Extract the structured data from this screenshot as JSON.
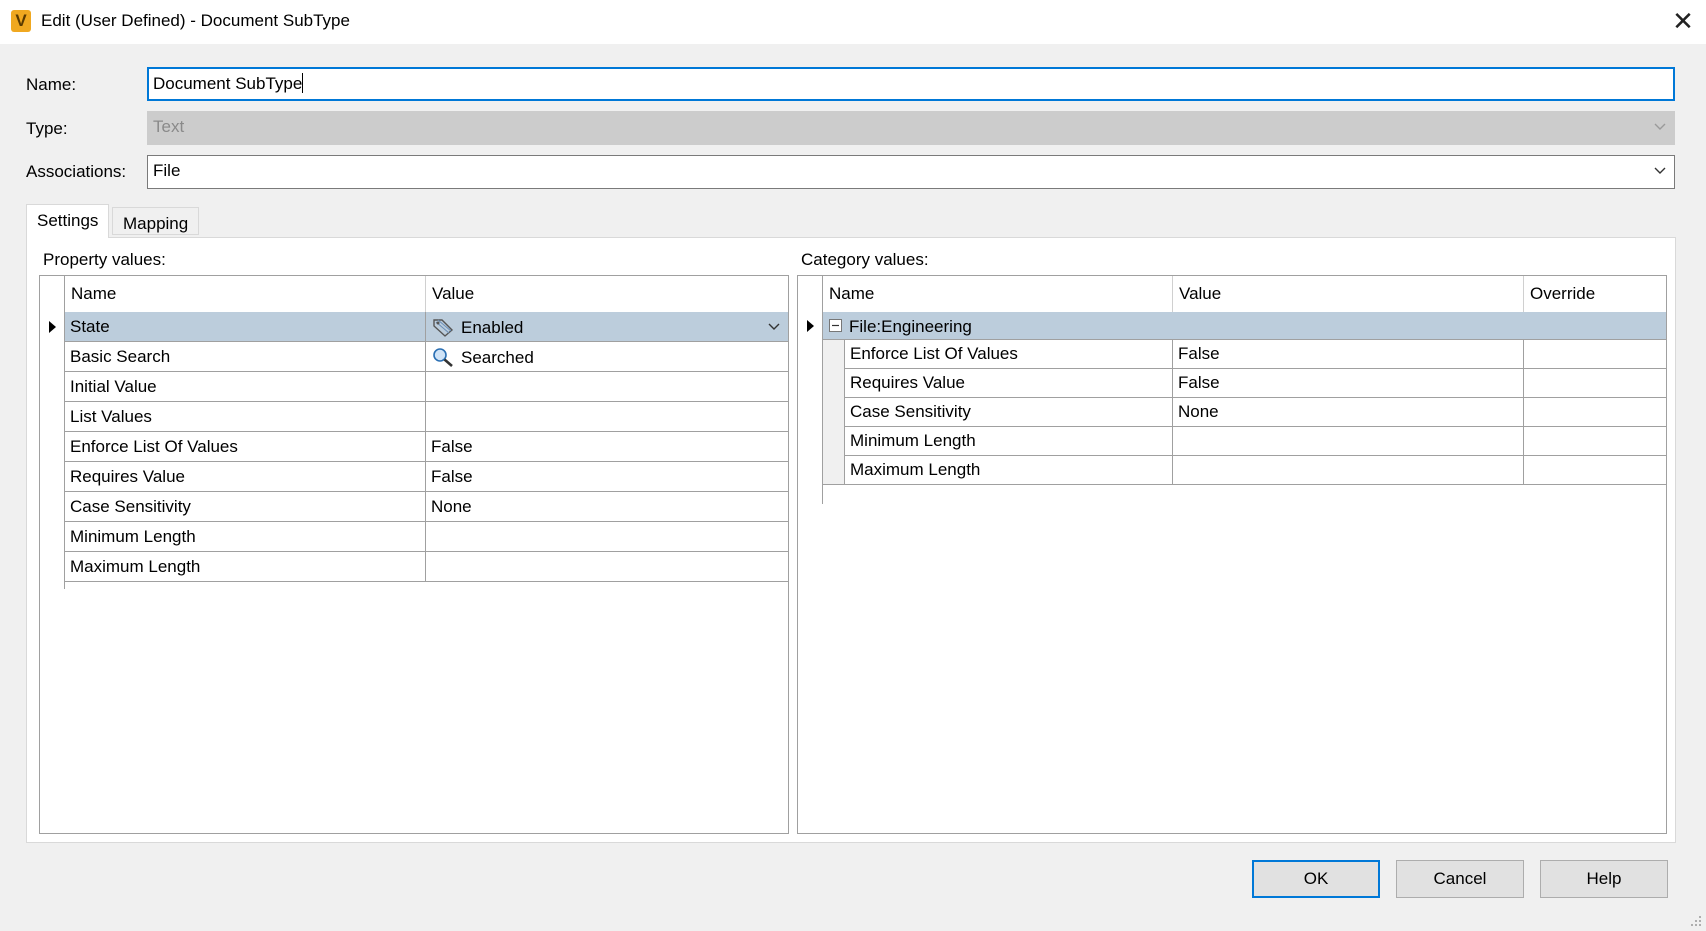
{
  "window": {
    "title": "Edit (User Defined) - Document SubType",
    "icon_letter": "V"
  },
  "form": {
    "name_label": "Name:",
    "name_value": "Document SubType",
    "type_label": "Type:",
    "type_value": "Text",
    "associations_label": "Associations:",
    "associations_value": "File"
  },
  "tabs": [
    {
      "label": "Settings",
      "active": true
    },
    {
      "label": "Mapping",
      "active": false
    }
  ],
  "property_values": {
    "section_label": "Property values:",
    "columns": [
      "Name",
      "Value"
    ],
    "rows": [
      {
        "name": "State",
        "value": "Enabled",
        "icon": "tag-icon",
        "selected": true
      },
      {
        "name": "Basic Search",
        "value": "Searched",
        "icon": "magnifier-icon"
      },
      {
        "name": "Initial Value",
        "value": ""
      },
      {
        "name": "List Values",
        "value": ""
      },
      {
        "name": "Enforce List Of Values",
        "value": "False"
      },
      {
        "name": "Requires Value",
        "value": "False"
      },
      {
        "name": "Case Sensitivity",
        "value": "None"
      },
      {
        "name": "Minimum Length",
        "value": ""
      },
      {
        "name": "Maximum Length",
        "value": ""
      }
    ]
  },
  "category_values": {
    "section_label": "Category values:",
    "columns": [
      "Name",
      "Value",
      "Override"
    ],
    "group": "File:Engineering",
    "rows": [
      {
        "name": "Enforce List Of Values",
        "value": "False",
        "override": ""
      },
      {
        "name": "Requires Value",
        "value": "False",
        "override": ""
      },
      {
        "name": "Case Sensitivity",
        "value": "None",
        "override": ""
      },
      {
        "name": "Minimum Length",
        "value": "",
        "override": ""
      },
      {
        "name": "Maximum Length",
        "value": "",
        "override": ""
      }
    ]
  },
  "buttons": {
    "ok": "OK",
    "cancel": "Cancel",
    "help": "Help"
  },
  "colors": {
    "accent": "#0078d7",
    "selected_row": "#bccddc",
    "dialog_bg": "#f0f0f0"
  }
}
